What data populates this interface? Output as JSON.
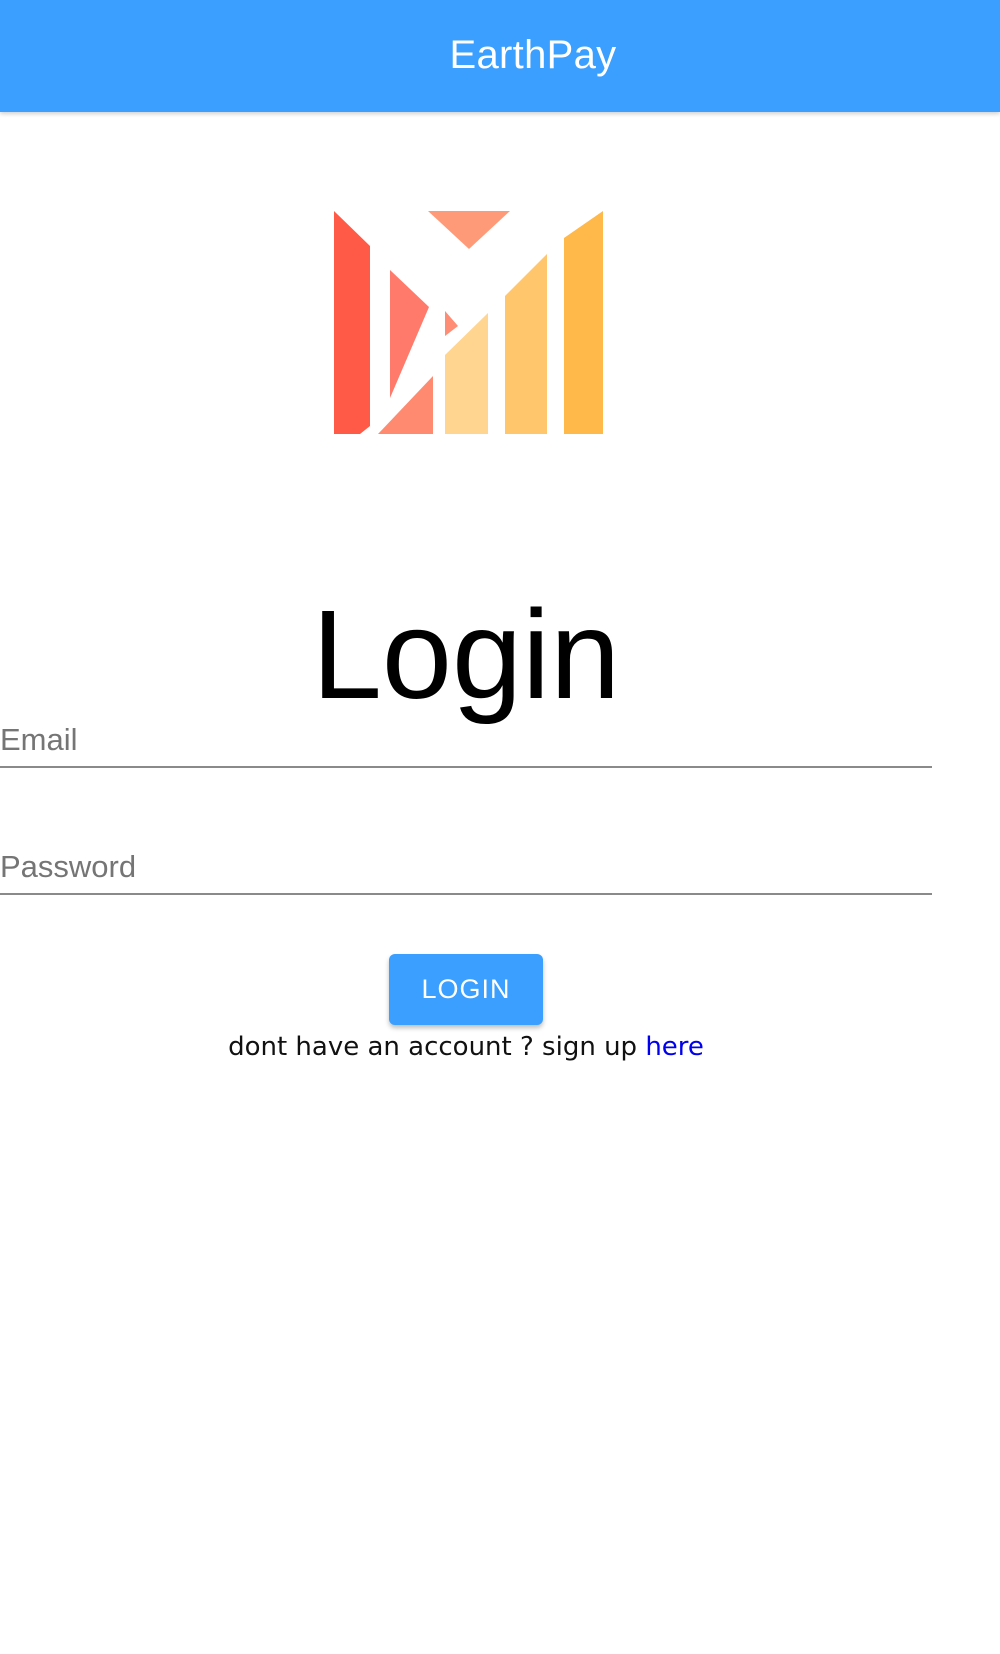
{
  "appbar": {
    "title": "EarthPay",
    "color": "#3a9ffe"
  },
  "logo": {
    "icon": "earthpay-logo-icon",
    "colors": [
      "#ff5a47",
      "#ff7a6a",
      "#ff9a78",
      "#ffd58f",
      "#ffc66c",
      "#ffb84a"
    ]
  },
  "page": {
    "heading": "Login"
  },
  "form": {
    "email_placeholder": "Email",
    "email_value": "",
    "password_placeholder": "Password",
    "password_value": "",
    "login_label": "LOGIN"
  },
  "signup": {
    "prompt": "dont have an account ? sign up ",
    "link_label": "here",
    "link_color": "#0000ee"
  }
}
